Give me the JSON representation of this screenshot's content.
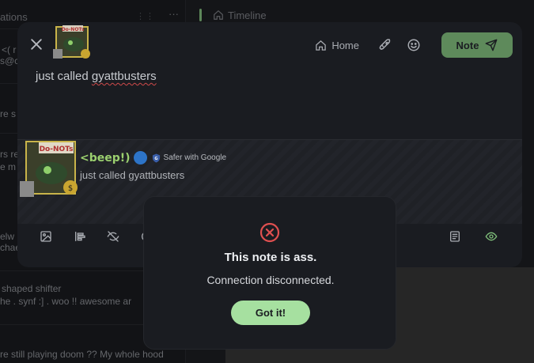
{
  "background": {
    "left_column_title": "ations",
    "timeline_label": "Timeline",
    "left_snippets": [
      "<( r",
      "s@c",
      "re s",
      "rs re",
      "e m",
      "elw",
      "chae",
      "shaped shifter",
      "he . synf :] . woo  !!   awesome ar",
      "re still playing doom ?? My whole hood"
    ]
  },
  "composer": {
    "close_icon": "close-icon",
    "header": {
      "home_label": "Home",
      "note_button_label": "Note"
    },
    "text": {
      "before": "just called ",
      "misspelled": "gyattbusters"
    },
    "preview": {
      "display_name": "<beep!)",
      "safer_label": "Safer with Google",
      "text": "just called gyattbusters",
      "avatar_label": "Do-NOTs"
    }
  },
  "dialog": {
    "icon": "error-circle-x-icon",
    "title": "This note is ass.",
    "message": "Connection disconnected.",
    "button_label": "Got it!"
  },
  "colors": {
    "accent_green": "#a6e0a0",
    "note_button": "#5e8a5b",
    "error_red": "#e05050",
    "panel": "#1a1c21"
  }
}
